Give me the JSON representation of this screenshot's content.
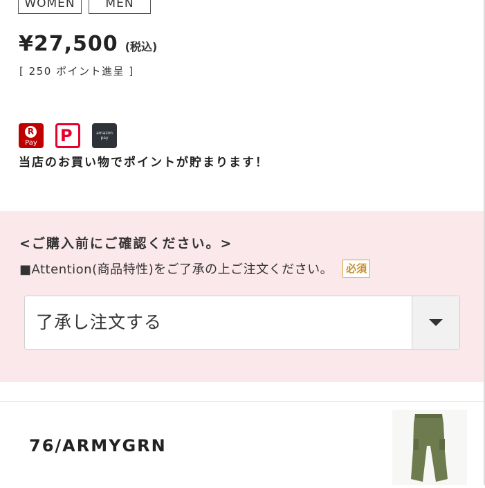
{
  "gender_tabs": [
    "WOMEN",
    "MEN"
  ],
  "price": {
    "value": "¥27,500",
    "tax_note": "(税込)"
  },
  "points_earned": "[ 250 ポイント進呈 ]",
  "payment_logos": {
    "rakuten_pay": {
      "mark": "R",
      "label": "Pay"
    },
    "paypay": {
      "mark": "P"
    },
    "amazon_pay": {
      "label": "amazon pay"
    }
  },
  "points_note": "当店のお買い物でポイントが貯まります！",
  "confirm": {
    "title": "<ご購入前にご確認ください。>",
    "attention_text": "■Attention(商品特性)をご了承の上ご注文ください。",
    "required_label": "必須",
    "select_value": "了承し注文する"
  },
  "variant": {
    "label": "76/ARMYGRN",
    "thumbnail": "army-green-pants-image"
  },
  "colors": {
    "panel_bg": "#fbe8ea",
    "required_accent": "#d9a13a",
    "rakuten_red": "#bf0000",
    "paypay_red": "#e6002d",
    "amazon_dark": "#2d3338",
    "pants_green": "#6e7b4e"
  }
}
